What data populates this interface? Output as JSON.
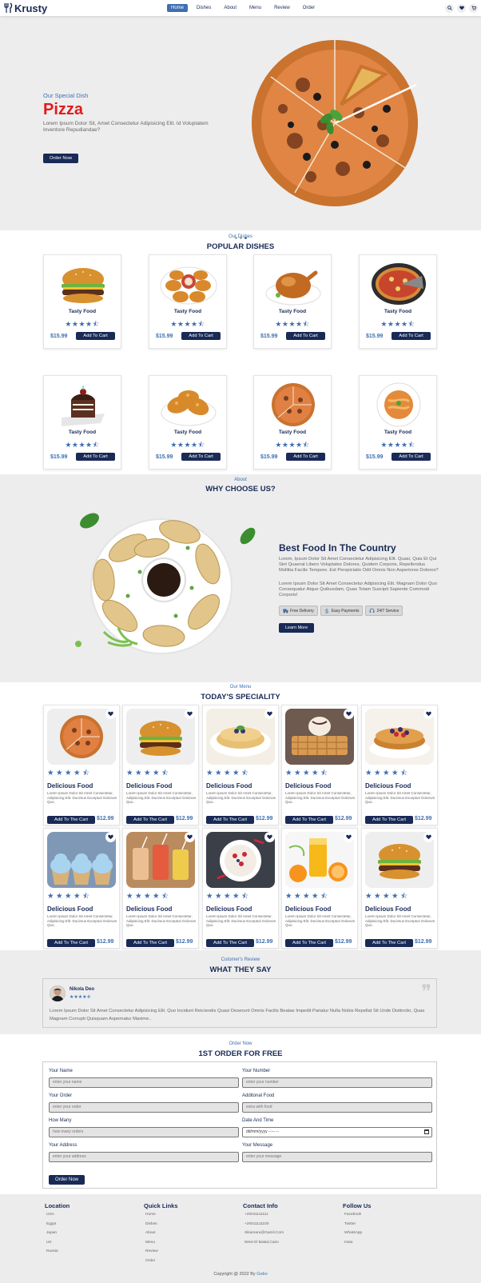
{
  "header": {
    "logo": "Krusty",
    "nav": [
      "Home",
      "Dishes",
      "About",
      "Menu",
      "Review",
      "Order"
    ],
    "active_nav": "Home"
  },
  "hero": {
    "subtitle": "Our Special Dish",
    "title": "Pizza",
    "description": "Lorem Ipsum Dolor Sit, Amet Consectetur Adipisicing Elit. Id Voluptatem Inventore Repudiandae?",
    "button": "Order Now"
  },
  "dishes": {
    "subtitle": "Our Dishes",
    "title": "POPULAR DISHES",
    "items": [
      {
        "name": "Tasty Food",
        "stars": "★★★★⯪",
        "price": "$15.99",
        "button": "Add To Cart",
        "image": "burger"
      },
      {
        "name": "Tasty Food",
        "stars": "★★★★⯪",
        "price": "$15.99",
        "button": "Add To Cart",
        "image": "nuggets"
      },
      {
        "name": "Tasty Food",
        "stars": "★★★★⯪",
        "price": "$15.99",
        "button": "Add To Cart",
        "image": "chicken"
      },
      {
        "name": "Tasty Food",
        "stars": "★★★★⯪",
        "price": "$15.99",
        "button": "Add To Cart",
        "image": "pizza-pan"
      },
      {
        "name": "Tasty Food",
        "stars": "★★★★⯪",
        "price": "$15.99",
        "button": "Add To Cart",
        "image": "cake"
      },
      {
        "name": "Tasty Food",
        "stars": "★★★★⯪",
        "price": "$15.99",
        "button": "Add To Cart",
        "image": "fried-chicken"
      },
      {
        "name": "Tasty Food",
        "stars": "★★★★⯪",
        "price": "$15.99",
        "button": "Add To Cart",
        "image": "pizza"
      },
      {
        "name": "Tasty Food",
        "stars": "★★★★⯪",
        "price": "$15.99",
        "button": "Add To Cart",
        "image": "pasta"
      }
    ]
  },
  "about": {
    "subtitle": "About",
    "title": "WHY CHOOSE US?",
    "heading": "Best Food In The Country",
    "p1": "Lorem, Ipsum Dolor Sit Amet Consectetur Adipisicing Elit. Quasi, Quia Et Qui Sint Quaerat Libero Voluptates Dolores, Quidem Corporis, Repellendus Mollitia Facilis Tempore. Est Perspiciatis Odit Omnis Non Asperiores Dolores?",
    "p2": "Lorem Ipsum Dolor Sit Amet Consectetur Adipisicing Elit. Magnam Dolor Quo Consequatur Atque Quibusdam, Quas Totam Suscipit Sapiente Commodi Corporis!",
    "badges": [
      "Free Delivery",
      "Easy Payments",
      "24/7 Service"
    ],
    "button": "Learn More"
  },
  "menu": {
    "subtitle": "Our Menu",
    "title": "TODAY'S SPECIALITY",
    "items": [
      {
        "name": "Delicious Food",
        "stars": "★★★★⯪",
        "desc": "Lorem Ipsum Dolor Sit Amet Consectetur, Adipisicing Elit. Ducimus Excepturi Dolorum Quo.",
        "button": "Add To The Cart",
        "price": "$12.99",
        "image": "pizza"
      },
      {
        "name": "Delicious Food",
        "stars": "★★★★⯪",
        "desc": "Lorem Ipsum Dolor Sit Amet Consectetur, Adipisicing Elit. Ducimus Excepturi Dolorum Quo.",
        "button": "Add To The Cart",
        "price": "$12.99",
        "image": "burger"
      },
      {
        "name": "Delicious Food",
        "stars": "★★★★⯪",
        "desc": "Lorem Ipsum Dolor Sit Amet Consectetur, Adipisicing Elit. Ducimus Excepturi Dolorum Quo.",
        "button": "Add To The Cart",
        "price": "$12.99",
        "image": "crepes"
      },
      {
        "name": "Delicious Food",
        "stars": "★★★★⯪",
        "desc": "Lorem Ipsum Dolor Sit Amet Consectetur, Adipisicing Elit. Ducimus Excepturi Dolorum Quo.",
        "button": "Add To The Cart",
        "price": "$12.99",
        "image": "waffles"
      },
      {
        "name": "Delicious Food",
        "stars": "★★★★⯪",
        "desc": "Lorem Ipsum Dolor Sit Amet Consectetur, Adipisicing Elit. Ducimus Excepturi Dolorum Quo.",
        "button": "Add To The Cart",
        "price": "$12.99",
        "image": "pancakes"
      },
      {
        "name": "Delicious Food",
        "stars": "★★★★⯪",
        "desc": "Lorem Ipsum Dolor Sit Amet Consectetur, Adipisicing Elit. Ducimus Excepturi Dolorum Quo.",
        "button": "Add To The Cart",
        "price": "$12.99",
        "image": "cupcakes"
      },
      {
        "name": "Delicious Food",
        "stars": "★★★★⯪",
        "desc": "Lorem Ipsum Dolor Sit Amet Consectetur, Adipisicing Elit. Ducimus Excepturi Dolorum Quo.",
        "button": "Add To The Cart",
        "price": "$12.99",
        "image": "drinks"
      },
      {
        "name": "Delicious Food",
        "stars": "★★★★⯪",
        "desc": "Lorem Ipsum Dolor Sit Amet Consectetur, Adipisicing Elit. Ducimus Excepturi Dolorum Quo.",
        "button": "Add To The Cart",
        "price": "$12.99",
        "image": "smoothie-bowl"
      },
      {
        "name": "Delicious Food",
        "stars": "★★★★⯪",
        "desc": "Lorem Ipsum Dolor Sit Amet Consectetur, Adipisicing Elit. Ducimus Excepturi Dolorum Quo.",
        "button": "Add To The Cart",
        "price": "$12.99",
        "image": "orange-juice"
      },
      {
        "name": "Delicious Food",
        "stars": "★★★★⯪",
        "desc": "Lorem Ipsum Dolor Sit Amet Consectetur, Adipisicing Elit. Ducimus Excepturi Dolorum Quo.",
        "button": "Add To The Cart",
        "price": "$12.99",
        "image": "burger"
      }
    ]
  },
  "review": {
    "subtitle": "Cutomer's Review",
    "title": "WHAT THEY SAY",
    "name": "Nikola Deo",
    "stars": "★★★★⯪",
    "text": "Lorem Ipsum Dolor Sit Amet Consectetur Adipisicing Elit. Quo Incidunt Reiciendis Quasi Deserunt Omnis Facilis Beatae Impedit Pariatur Nulla Nobis Repellat Sit Unde Distinctio, Quas Magnam Corrupti Quisquam Aspernatur Maxime.."
  },
  "order": {
    "subtitle": "Order Now",
    "title": "1ST ORDER FOR FREE",
    "fields": [
      {
        "label": "Your Name",
        "placeholder": "enter your name"
      },
      {
        "label": "Your Number",
        "placeholder": "enter your number"
      },
      {
        "label": "Your Order",
        "placeholder": "enter your order"
      },
      {
        "label": "Additonal Food",
        "placeholder": "extra with food"
      },
      {
        "label": "How Many",
        "placeholder": "how many orders"
      },
      {
        "label": "Date And Time",
        "placeholder": "dd/mm/yyyy --:-- --"
      },
      {
        "label": "Your Address",
        "placeholder": "enter your address"
      },
      {
        "label": "Your Message",
        "placeholder": "enter your message"
      }
    ],
    "button": "Order Now"
  },
  "footer": {
    "location": {
      "title": "Location",
      "items": [
        "USA",
        "Egypt",
        "Japan",
        "UK",
        "Russia"
      ]
    },
    "quick_links": {
      "title": "Quick Links",
      "items": [
        "Home",
        "Dishes",
        "About",
        "Menu",
        "Review",
        "Order"
      ]
    },
    "contact": {
      "title": "Contact Info",
      "items": [
        "+20011111111",
        "+20011111100",
        "Sikamaru@Gamil.Com",
        "West El Balad,Cairo"
      ]
    },
    "follow": {
      "title": "Follow Us",
      "items": [
        "Facebook",
        "Twitter",
        "WhatsApp",
        "Insta"
      ]
    },
    "copyright": "Copyright @ 2022 By",
    "author": "Gobo"
  },
  "colors": {
    "navy": "#192a56",
    "accent": "#3e6fb0",
    "title_red": "#e21b1b",
    "section_bg": "#ededee"
  }
}
